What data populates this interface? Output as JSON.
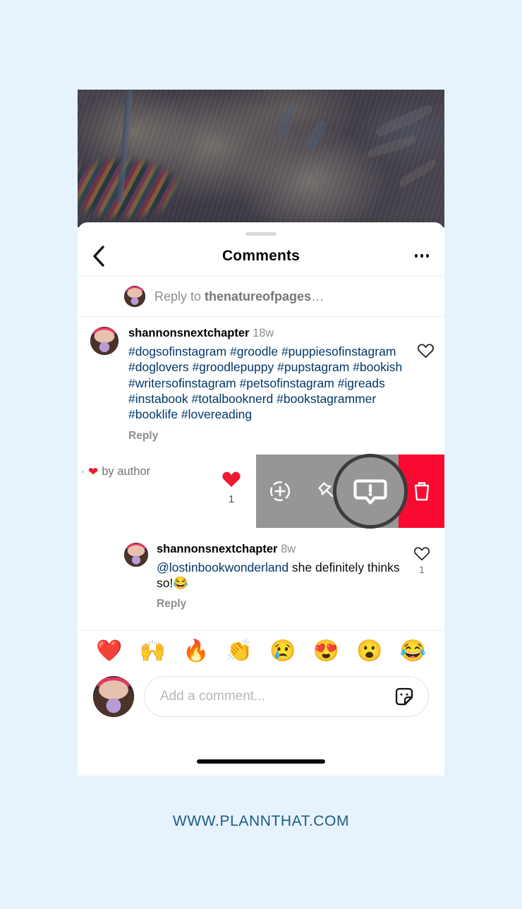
{
  "footer": {
    "url": "WWW.PLANNTHAT.COM"
  },
  "post": {
    "image_alt": "cream colored fluffy dog lying on a multicolored knit blanket"
  },
  "sheet": {
    "title": "Comments",
    "back_icon": "chevron-left-icon",
    "more_icon": "more-options-icon",
    "grabber": "drag-handle"
  },
  "reply_to": {
    "prefix": "Reply to ",
    "username": "thenatureofpages",
    "ellipsis": "…"
  },
  "comments": [
    {
      "username": "shannonsnextchapter",
      "time": "18w",
      "text": "#dogsofinstagram #groodle #puppiesofinstagram #doglovers #groodlepuppy #pupstagram #bookish #writersofinstagram #petsofinstagram #igreads #instabook #totalbooknerd #bookstagrammer #booklife #lovereading",
      "reply_label": "Reply",
      "like_icon": "heart-outline-icon",
      "like_count": ""
    },
    {
      "username": "shannonsnextchapter",
      "time": "8w",
      "mention": "@lostinbookwonderland",
      "text": " she definitely thinks so!😂",
      "reply_label": "Reply",
      "like_icon": "heart-outline-icon",
      "like_count": "1"
    }
  ],
  "swiped_comment": {
    "meta_text": "w · ",
    "meta_suffix": " by author",
    "meta_heart": "❤",
    "like_count": "1",
    "like_icon": "heart-filled-icon",
    "actions": [
      {
        "name": "add-to-story",
        "icon": "add-to-story-icon",
        "label": ""
      },
      {
        "name": "pin-comment",
        "icon": "pin-icon",
        "label": ""
      },
      {
        "name": "report-comment",
        "icon": "report-icon",
        "label": "",
        "highlighted": true
      },
      {
        "name": "delete-comment",
        "icon": "trash-icon",
        "label": ""
      }
    ],
    "colors": {
      "panel": "#969696",
      "delete": "#fa0a32",
      "highlight_ring": "#3b3b3b"
    }
  },
  "emoji_bar": {
    "emojis": [
      "❤️",
      "🙌",
      "🔥",
      "👏",
      "😢",
      "😍",
      "😮",
      "😂"
    ]
  },
  "composer": {
    "placeholder": "Add a comment...",
    "value": "",
    "sticker_icon": "sticker-icon"
  },
  "colors": {
    "background": "#e6f3fc",
    "link": "#00376b",
    "muted": "#8e8e8e",
    "footer_text": "#1c5a86"
  }
}
